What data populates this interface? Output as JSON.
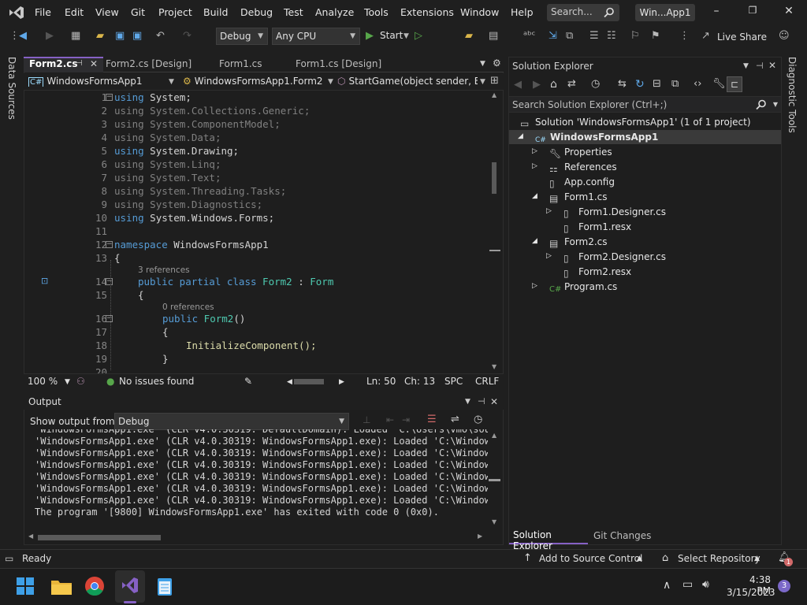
{
  "menu": [
    "File",
    "Edit",
    "View",
    "Git",
    "Project",
    "Build",
    "Debug",
    "Test",
    "Analyze",
    "Tools",
    "Extensions",
    "Window",
    "Help"
  ],
  "search_placeholder": "Search...",
  "solution_title": "Win...App1",
  "toolbar": {
    "config": "Debug",
    "platform": "Any CPU",
    "start_label": "Start",
    "live_share": "Live Share"
  },
  "left_strip": "Data Sources",
  "right_strip": "Diagnostic Tools",
  "editor": {
    "tabs": [
      "Form2.cs",
      "Form2.cs [Design]",
      "Form1.cs",
      "Form1.cs [Design]"
    ],
    "nav": [
      "WindowsFormsApp1",
      "WindowsFormsApp1.Form2",
      "StartGame(object sender, Ever"
    ],
    "line_numbers": [
      "1",
      "2",
      "3",
      "4",
      "5",
      "6",
      "7",
      "8",
      "9",
      "10",
      "11",
      "12",
      "13",
      "14",
      "15",
      "16",
      "17",
      "18",
      "19",
      "20"
    ],
    "code_lines": [
      {
        "kw": "using",
        "rest": " System;",
        "dim": false
      },
      {
        "kw": "using",
        "rest": " System.Collections.Generic;",
        "dim": true
      },
      {
        "kw": "using",
        "rest": " System.ComponentModel;",
        "dim": true
      },
      {
        "kw": "using",
        "rest": " System.Data;",
        "dim": true
      },
      {
        "kw": "using",
        "rest": " System.Drawing;",
        "dim": false
      },
      {
        "kw": "using",
        "rest": " System.Linq;",
        "dim": true
      },
      {
        "kw": "using",
        "rest": " System.Text;",
        "dim": true
      },
      {
        "kw": "using",
        "rest": " System.Threading.Tasks;",
        "dim": true
      },
      {
        "kw": "using",
        "rest": " System.Diagnostics;",
        "dim": true
      },
      {
        "kw": "using",
        "rest": " System.Windows.Forms;",
        "dim": false
      }
    ],
    "ns_kw": "namespace",
    "ns_name": " WindowsFormsApp1",
    "brace_open": "{",
    "refs_3": "3 references",
    "class_mods": "public partial class",
    "class_name": " Form2",
    "class_base_sep": " : ",
    "class_base": "Form",
    "refs_0": "0 references",
    "ctor_kw": "public",
    "ctor_name": " Form2",
    "ctor_parens": "()",
    "init_call": "InitializeComponent();",
    "brace_close": "}",
    "zoom": "100 %",
    "issues": "No issues found",
    "line": "Ln: 50",
    "col": "Ch: 13",
    "indent": "SPC",
    "eol": "CRLF"
  },
  "output": {
    "title": "Output",
    "show_from_label": "Show output from:",
    "show_from_value": "Debug",
    "lines": [
      "'WindowsFormsApp1.exe' (CLR v4.0.30319: DefaultDomain): Loaded 'C:\\Users\\vmo\\sourc",
      "'WindowsFormsApp1.exe' (CLR v4.0.30319: WindowsFormsApp1.exe): Loaded 'C:\\Windows\\",
      "'WindowsFormsApp1.exe' (CLR v4.0.30319: WindowsFormsApp1.exe): Loaded 'C:\\Windows\\",
      "'WindowsFormsApp1.exe' (CLR v4.0.30319: WindowsFormsApp1.exe): Loaded 'C:\\Windows\\",
      "'WindowsFormsApp1.exe' (CLR v4.0.30319: WindowsFormsApp1.exe): Loaded 'C:\\Windows\\",
      "'WindowsFormsApp1.exe' (CLR v4.0.30319: WindowsFormsApp1.exe): Loaded 'C:\\Windows\\",
      "'WindowsFormsApp1.exe' (CLR v4.0.30319: WindowsFormsApp1.exe): Loaded 'C:\\Windows\\",
      "The program '[9800] WindowsFormsApp1.exe' has exited with code 0 (0x0)."
    ]
  },
  "solution_explorer": {
    "title": "Solution Explorer",
    "search_placeholder": "Search Solution Explorer (Ctrl+;)",
    "solution": "Solution 'WindowsFormsApp1' (1 of 1 project)",
    "project": "WindowsFormsApp1",
    "items": {
      "properties": "Properties",
      "references": "References",
      "app_config": "App.config",
      "form1": "Form1.cs",
      "form1_designer": "Form1.Designer.cs",
      "form1_resx": "Form1.resx",
      "form2": "Form2.cs",
      "form2_designer": "Form2.Designer.cs",
      "form2_resx": "Form2.resx",
      "program": "Program.cs"
    },
    "bottom_tabs": [
      "Solution Explorer",
      "Git Changes"
    ]
  },
  "status": {
    "ready": "Ready",
    "source_control": "Add to Source Control",
    "repository": "Select Repository",
    "notifications": "1"
  },
  "taskbar": {
    "time": "4:38 PM",
    "date": "3/15/2023",
    "badge": "3"
  },
  "colors": {
    "accent_vs": "#8661c5",
    "keyword": "#569cd6",
    "type": "#4ec9b0",
    "start_green": "#57a64a"
  }
}
